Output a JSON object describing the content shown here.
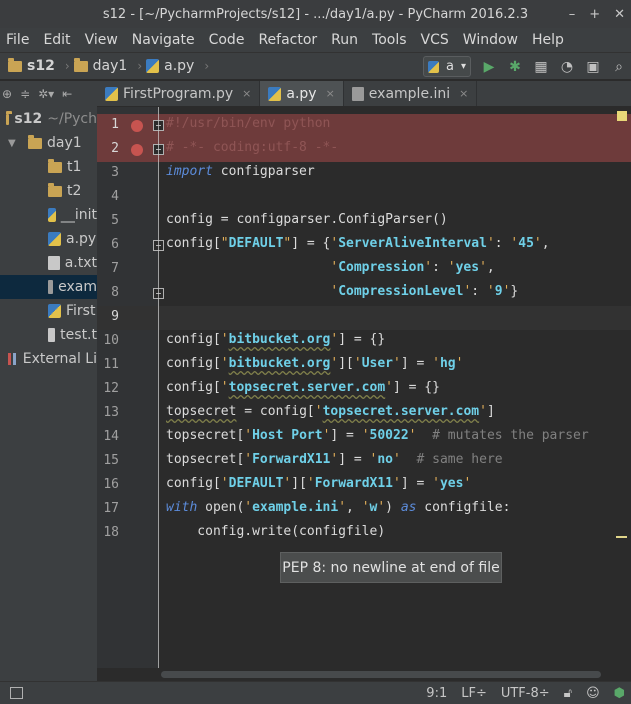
{
  "window": {
    "title": "s12 - [~/PycharmProjects/s12] - .../day1/a.py - PyCharm 2016.2.3",
    "minimize": "–",
    "maximize": "+",
    "close": "✕"
  },
  "menu": [
    "File",
    "Edit",
    "View",
    "Navigate",
    "Code",
    "Refactor",
    "Run",
    "Tools",
    "VCS",
    "Window",
    "Help"
  ],
  "breadcrumb": [
    "s12",
    "day1",
    "a.py"
  ],
  "run_config": {
    "selected": "a",
    "caret": "▾"
  },
  "toolbar_icons": [
    "run-icon",
    "debug-icon",
    "coverage-icon",
    "profile-icon",
    "search-icon"
  ],
  "tabs": [
    {
      "label": "FirstProgram.py",
      "icon": "python-file-icon",
      "close": "×",
      "active": false
    },
    {
      "label": "a.py",
      "icon": "python-file-icon",
      "close": "×",
      "active": true
    },
    {
      "label": "example.ini",
      "icon": "ini-file-icon",
      "close": "×",
      "active": false
    }
  ],
  "project_tree": [
    {
      "label": "s12",
      "extra": "~/Pych",
      "icon": "folder-icon",
      "indent": 0,
      "arrow": "",
      "selected": false
    },
    {
      "label": "day1",
      "extra": "",
      "icon": "folder-icon",
      "indent": 1,
      "arrow": "▼",
      "selected": false
    },
    {
      "label": "t1",
      "extra": "",
      "icon": "folder-icon",
      "indent": 2,
      "arrow": "",
      "selected": false
    },
    {
      "label": "t2",
      "extra": "",
      "icon": "folder-icon",
      "indent": 2,
      "arrow": "",
      "selected": false
    },
    {
      "label": "__init",
      "extra": "",
      "icon": "python-file-icon",
      "indent": 2,
      "arrow": "",
      "selected": false
    },
    {
      "label": "a.py",
      "extra": "",
      "icon": "python-file-icon",
      "indent": 2,
      "arrow": "",
      "selected": false
    },
    {
      "label": "a.txt",
      "extra": "",
      "icon": "text-file-icon",
      "indent": 2,
      "arrow": "",
      "selected": false
    },
    {
      "label": "exam",
      "extra": "",
      "icon": "ini-file-icon",
      "indent": 2,
      "arrow": "",
      "selected": true
    },
    {
      "label": "First",
      "extra": "",
      "icon": "python-file-icon",
      "indent": 2,
      "arrow": "",
      "selected": false
    },
    {
      "label": "test.t",
      "extra": "",
      "icon": "text-file-icon",
      "indent": 2,
      "arrow": "",
      "selected": false
    },
    {
      "label": "External Li",
      "extra": "",
      "icon": "library-icon",
      "indent": 0,
      "arrow": "",
      "selected": false
    }
  ],
  "code_lines": [
    {
      "num": "1",
      "text": "#!/usr/bin/env python",
      "breakpoint": true
    },
    {
      "num": "2",
      "text": "# -*- coding:utf-8 -*-",
      "breakpoint": true
    },
    {
      "num": "3",
      "text": "import configparser"
    },
    {
      "num": "4",
      "text": ""
    },
    {
      "num": "5",
      "text": "config = configparser.ConfigParser()"
    },
    {
      "num": "6",
      "text": "config[\"DEFAULT\"] = {'ServerAliveInterval': '45',"
    },
    {
      "num": "7",
      "text": "                     'Compression': 'yes',"
    },
    {
      "num": "8",
      "text": "                     'CompressionLevel': '9'}"
    },
    {
      "num": "9",
      "text": "",
      "current": true
    },
    {
      "num": "10",
      "text": "config['bitbucket.org'] = {}"
    },
    {
      "num": "11",
      "text": "config['bitbucket.org']['User'] = 'hg'"
    },
    {
      "num": "12",
      "text": "config['topsecret.server.com'] = {}"
    },
    {
      "num": "13",
      "text": "topsecret = config['topsecret.server.com']"
    },
    {
      "num": "14",
      "text": "topsecret['Host Port'] = '50022'  # mutates the parser"
    },
    {
      "num": "15",
      "text": "topsecret['ForwardX11'] = 'no'  # same here"
    },
    {
      "num": "16",
      "text": "config['DEFAULT']['ForwardX11'] = 'yes'"
    },
    {
      "num": "17",
      "text": "with open('example.ini', 'w') as configfile:"
    },
    {
      "num": "18",
      "text": "    config.write(configfile)"
    }
  ],
  "tooltip": "PEP 8: no newline at end of file",
  "status": {
    "position": "9:1",
    "line_sep": "LF÷",
    "encoding": "UTF-8÷"
  },
  "colors": {
    "breakpoint_line": "#6e3b3b",
    "breakpoint_dot": "#c75450",
    "string": "#6fd0e8",
    "keyword": "#5c8cdb"
  }
}
